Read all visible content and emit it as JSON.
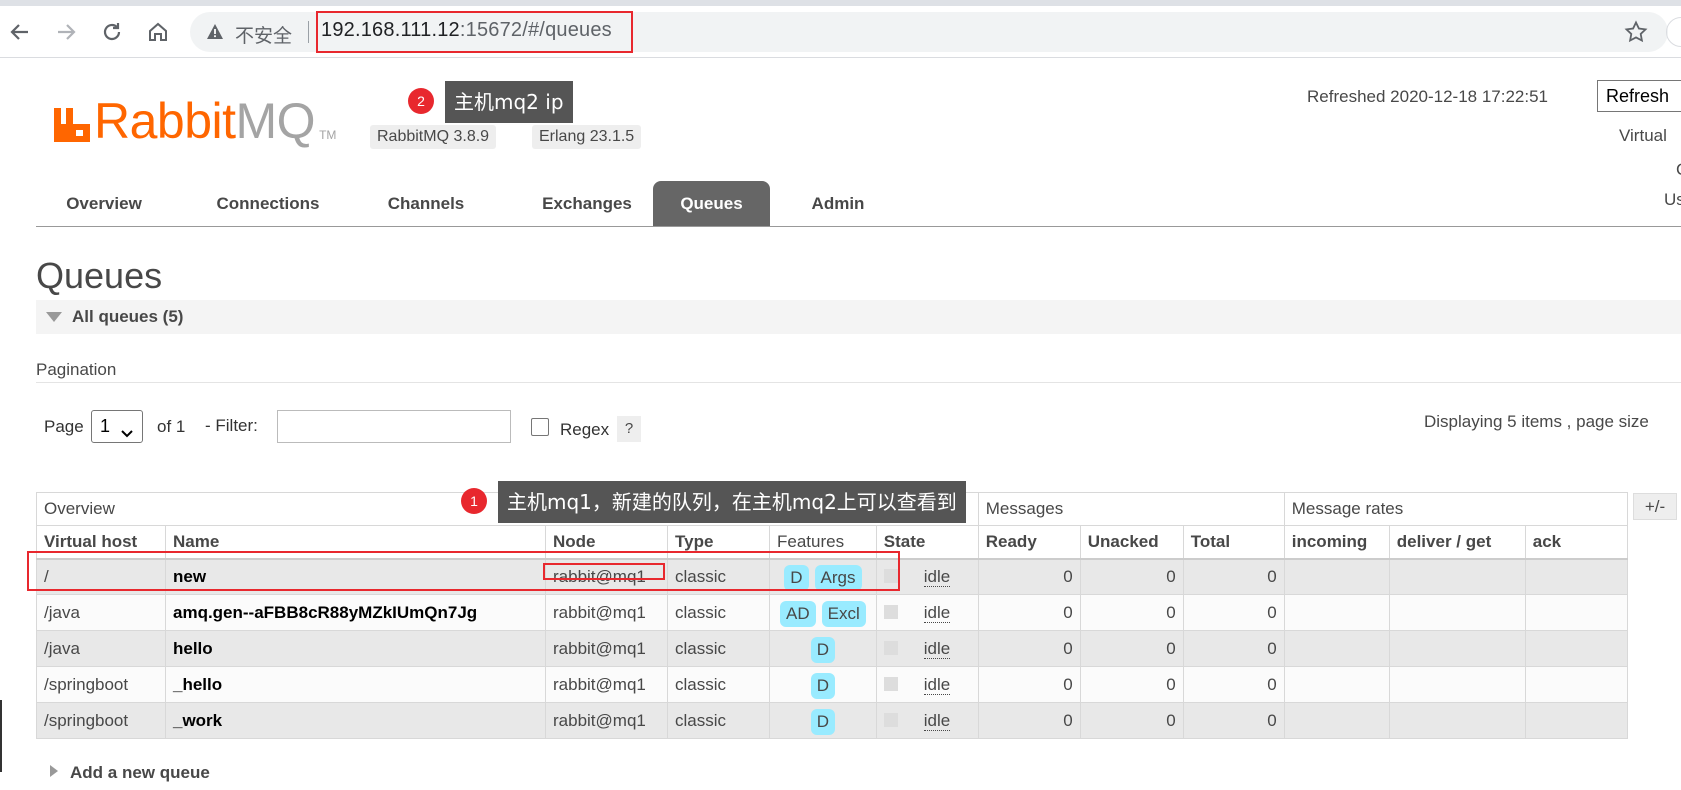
{
  "browser": {
    "insecure_label": "不安全",
    "url_host": "192.168.111.12",
    "url_rest": ":15672/#/queues"
  },
  "header": {
    "logo_rabbit": "Rabbit",
    "logo_mq": "MQ",
    "logo_tm": "TM",
    "rabbitmq_version": "RabbitMQ 3.8.9",
    "erlang_version": "Erlang 23.1.5",
    "refreshed": "Refreshed 2020-12-18 17:22:51",
    "refresh_button": "Refresh",
    "virtual_label": "Virtual",
    "side_c": "C",
    "side_us": "Us"
  },
  "tabs": [
    {
      "label": "Overview"
    },
    {
      "label": "Connections"
    },
    {
      "label": "Channels"
    },
    {
      "label": "Exchanges"
    },
    {
      "label": "Queues"
    },
    {
      "label": "Admin"
    }
  ],
  "page": {
    "title": "Queues",
    "section": "All queues (5)",
    "pagination_label": "Pagination",
    "page_label": "Page",
    "page_value": "1",
    "of_label": "of 1",
    "filter_label": "- Filter:",
    "regex_label": "Regex",
    "help": "?",
    "displaying": "Displaying 5 items , page size",
    "add_queue": "Add a new queue",
    "plusminus": "+/-"
  },
  "table": {
    "groups": [
      "Overview",
      "Messages",
      "Message rates"
    ],
    "columns": [
      "Virtual host",
      "Name",
      "Node",
      "Type",
      "Features",
      "State",
      "Ready",
      "Unacked",
      "Total",
      "incoming",
      "deliver / get",
      "ack"
    ],
    "rows": [
      {
        "vhost": "/",
        "name": "new",
        "node": "rabbit@mq1",
        "type": "classic",
        "features": [
          "D",
          "Args"
        ],
        "state": "idle",
        "ready": "0",
        "unacked": "0",
        "total": "0"
      },
      {
        "vhost": "/java",
        "name": "amq.gen--aFBB8cR88yMZkIUmQn7Jg",
        "node": "rabbit@mq1",
        "type": "classic",
        "features": [
          "AD",
          "Excl"
        ],
        "state": "idle",
        "ready": "0",
        "unacked": "0",
        "total": "0"
      },
      {
        "vhost": "/java",
        "name": "hello",
        "node": "rabbit@mq1",
        "type": "classic",
        "features": [
          "D"
        ],
        "state": "idle",
        "ready": "0",
        "unacked": "0",
        "total": "0"
      },
      {
        "vhost": "/springboot",
        "name": "_hello",
        "node": "rabbit@mq1",
        "type": "classic",
        "features": [
          "D"
        ],
        "state": "idle",
        "ready": "0",
        "unacked": "0",
        "total": "0"
      },
      {
        "vhost": "/springboot",
        "name": "_work",
        "node": "rabbit@mq1",
        "type": "classic",
        "features": [
          "D"
        ],
        "state": "idle",
        "ready": "0",
        "unacked": "0",
        "total": "0"
      }
    ]
  },
  "annotations": {
    "callout1_num": "1",
    "callout1_text": "主机mq1，新建的队列，在主机mq2上可以查看到",
    "callout2_num": "2",
    "callout2_text": "主机mq2 ip"
  },
  "colors": {
    "brand_orange": "#ff6600",
    "active_tab": "#666666",
    "feature_tag": "#99ebff",
    "annotation_red": "#e8282e"
  }
}
